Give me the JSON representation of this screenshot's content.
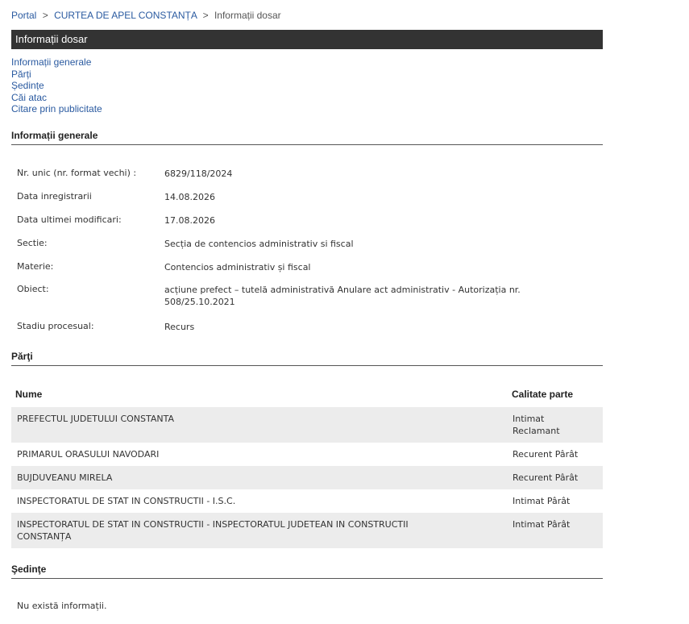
{
  "breadcrumb": {
    "items": [
      "Portal",
      "CURTEA DE APEL CONSTANȚA"
    ],
    "current": "Informații dosar",
    "separator": ">"
  },
  "title": "Informații dosar",
  "nav": [
    "Informații generale",
    "Părți",
    "Ședințe",
    "Căi atac",
    "Citare prin publicitate"
  ],
  "general": {
    "heading": "Informații generale",
    "rows": [
      {
        "label": "Nr. unic (nr. format vechi) :",
        "value": "6829/118/2024"
      },
      {
        "label": "Data inregistrarii",
        "value": "14.08.2026"
      },
      {
        "label": "Data ultimei modificari:",
        "value": "17.08.2026"
      },
      {
        "label": "Sectie:",
        "value": "Secția de contencios administrativ si fiscal"
      },
      {
        "label": "Materie:",
        "value": "Contencios administrativ și fiscal"
      },
      {
        "label": "Obiect:",
        "value": "acțiune prefect – tutelă administrativă Anulare act administrativ - Autorizația nr. 508/25.10.2021"
      },
      {
        "label": "Stadiu procesual:",
        "value": "Recurs"
      }
    ]
  },
  "parti": {
    "heading": "Părţi",
    "col_name": "Nume",
    "col_role": "Calitate parte",
    "rows": [
      {
        "name": "PREFECTUL JUDETULUI CONSTANTA",
        "role": "Intimat Reclamant"
      },
      {
        "name": "PRIMARUL ORASULUI NAVODARI",
        "role": "Recurent Pârât"
      },
      {
        "name": "BUJDUVEANU MIRELA",
        "role": "Recurent Pârât"
      },
      {
        "name": "INSPECTORATUL DE STAT IN CONSTRUCTII - I.S.C.",
        "role": "Intimat Pârât"
      },
      {
        "name": "INSPECTORATUL DE STAT IN CONSTRUCTII - INSPECTORATUL JUDETEAN IN CONSTRUCTII CONSTANȚA",
        "role": "Intimat Pârât"
      }
    ]
  },
  "sedinte": {
    "heading": "Şedinţe",
    "empty_text": "Nu există informații."
  }
}
